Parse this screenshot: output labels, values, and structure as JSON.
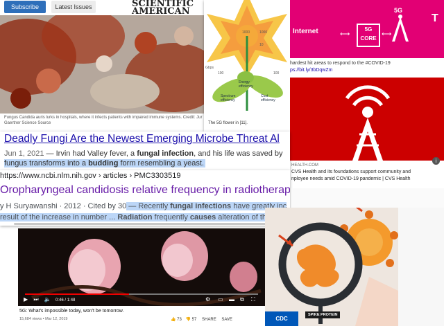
{
  "sciam": {
    "subscribe": "Subscribe",
    "latest": "Latest Issues",
    "logo_line1": "SCIENTIFIC",
    "logo_line2": "AMERICAN",
    "caption": "Fungus Candida auris lurks in hospitals, where it infects patients with impaired immune systems. Credit: Jur",
    "caption2": "Gaertner Science Source"
  },
  "flower": {
    "caption": "The 5G flower in [11].",
    "labels": [
      "Spectrum efficiency",
      "Energy efficiency",
      "Cost efficiency",
      "Gbps",
      "1000",
      "1000",
      "100",
      "100",
      "10"
    ]
  },
  "tmobile": {
    "internet": "Internet",
    "core_label": "5G CORE",
    "g5": "5G",
    "tweet1": "hardest hit areas to respond to the #COVID-19",
    "tweet2": "ps://bit.ly/3bDqwZm"
  },
  "cvs": {
    "source": "HEALTH.COM",
    "line1": "CVS Health and its foundations support community and",
    "line2": "nployee needs amid COVID-19 pandemic | CVS Health",
    "info_icon": "i"
  },
  "result1": {
    "title": "Deadly Fungi Are the Newest Emerging Microbe Threat Al",
    "date": "Jun 1, 2021",
    "snippet_a": " — Irvin had Valley fever, a ",
    "snippet_b": "fungal infection",
    "snippet_c": ", and his life was saved by",
    "snippet_d": "fungus transforms into a ",
    "snippet_e": "budding",
    "snippet_f": " form resembling a yeast."
  },
  "result2": {
    "url": "https://www.ncbi.nlm.nih.gov › articles › PMC3303519",
    "title": "Oropharyngeal candidosis relative frequency in radiotherapy",
    "meta": "y H Suryawanshi · 2012 · Cited by 30",
    "snip1": " — Recently ",
    "snip2": "fungal infections",
    "snip3": " have greatly inc",
    "snip4": "result of the increase in number ... ",
    "snip5": "Radiation",
    "snip6": " frequently ",
    "snip7": "causes",
    "snip8": " alteration of the ora"
  },
  "youtube": {
    "time": "0:46 / 1:48",
    "title": "5G: What's impossible today, won't be tomorrow.",
    "views": "15,684 views • Mar 12, 2019",
    "likes": "73",
    "dislikes": "57",
    "share": "SHARE",
    "save": "SAVE"
  },
  "spike": {
    "label": "SPIKE PROTEIN",
    "cdc": "CDC"
  }
}
